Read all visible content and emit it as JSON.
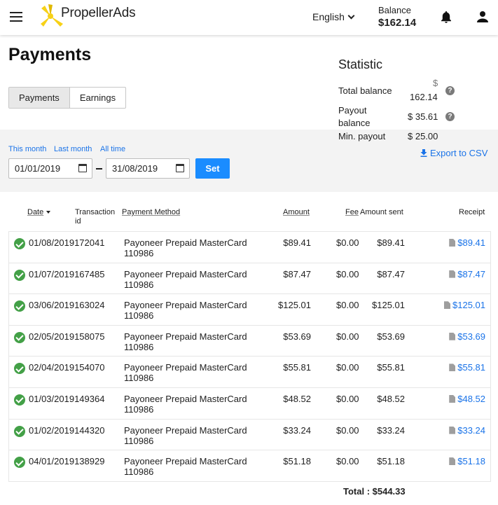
{
  "header": {
    "brand": "PropellerAds",
    "language": "English",
    "balance_label": "Balance",
    "balance_value": "$162.14"
  },
  "page": {
    "title": "Payments",
    "tabs": [
      "Payments",
      "Earnings"
    ]
  },
  "statistic": {
    "title": "Statistic",
    "total_balance_label": "Total balance",
    "total_balance_currency": "$",
    "total_balance_value": "162.14",
    "payout_balance_label_1": "Payout",
    "payout_balance_label_2": "balance",
    "payout_balance_value": "$ 35.61",
    "min_payout_label": "Min. payout",
    "min_payout_value": "$ 25.00"
  },
  "filters": {
    "quick": [
      "This month",
      "Last month",
      "All time"
    ],
    "date_from": "01/01/2019",
    "date_to": "31/08/2019",
    "set_label": "Set",
    "export_label": "Export to CSV"
  },
  "table": {
    "columns": {
      "date": "Date",
      "transaction_1": "Transaction",
      "transaction_2": "id",
      "method": "Payment Method",
      "amount": "Amount",
      "fee": "Fee",
      "sent": "Amount sent",
      "receipt": "Receipt"
    },
    "rows": [
      {
        "date_id": "01/08/2019172041",
        "method_1": "Payoneer Prepaid MasterCard",
        "method_2": "110986",
        "amount": "$89.41",
        "fee": "$0.00",
        "sent": "$89.41",
        "receipt": "$89.41"
      },
      {
        "date_id": "01/07/2019167485",
        "method_1": "Payoneer Prepaid MasterCard",
        "method_2": "110986",
        "amount": "$87.47",
        "fee": "$0.00",
        "sent": "$87.47",
        "receipt": "$87.47"
      },
      {
        "date_id": "03/06/2019163024",
        "method_1": "Payoneer Prepaid MasterCard",
        "method_2": "110986",
        "amount": "$125.01",
        "fee": "$0.00",
        "sent": "$125.01",
        "receipt": "$125.01"
      },
      {
        "date_id": "02/05/2019158075",
        "method_1": "Payoneer Prepaid MasterCard",
        "method_2": "110986",
        "amount": "$53.69",
        "fee": "$0.00",
        "sent": "$53.69",
        "receipt": "$53.69"
      },
      {
        "date_id": "02/04/2019154070",
        "method_1": "Payoneer Prepaid MasterCard",
        "method_2": "110986",
        "amount": "$55.81",
        "fee": "$0.00",
        "sent": "$55.81",
        "receipt": "$55.81"
      },
      {
        "date_id": "01/03/2019149364",
        "method_1": "Payoneer Prepaid MasterCard",
        "method_2": "110986",
        "amount": "$48.52",
        "fee": "$0.00",
        "sent": "$48.52",
        "receipt": "$48.52"
      },
      {
        "date_id": "01/02/2019144320",
        "method_1": "Payoneer Prepaid MasterCard",
        "method_2": "110986",
        "amount": "$33.24",
        "fee": "$0.00",
        "sent": "$33.24",
        "receipt": "$33.24"
      },
      {
        "date_id": "04/01/2019138929",
        "method_1": "Payoneer Prepaid MasterCard",
        "method_2": "110986",
        "amount": "$51.18",
        "fee": "$0.00",
        "sent": "$51.18",
        "receipt": "$51.18"
      }
    ],
    "total": "Total : $544.33"
  },
  "colors": {
    "accent": "#1a8cff",
    "link": "#1a73e8",
    "success": "#43a047",
    "band": "#f3f3f3"
  }
}
